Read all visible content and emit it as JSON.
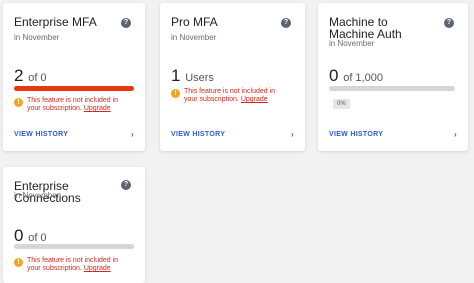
{
  "colors": {
    "accent_link": "#2a5bd7",
    "danger": "#d6261b",
    "warning_icon": "#f1a51d",
    "bar_fill_over": "#e8380d",
    "bar_track": "#d6d6d6"
  },
  "cards": [
    {
      "title": "Enterprise MFA",
      "period": "in November",
      "usage_value": "2",
      "usage_suffix": "of 0",
      "usage_fraction": 1.0,
      "warning_text": "This feature is not included in your subscription.",
      "warning_link": "Upgrade",
      "view_history": "VIEW HISTORY",
      "help_icon": "question-circle-icon",
      "warn_icon": "exclamation-circle-icon",
      "chevron_icon": "chevron-right-icon"
    },
    {
      "title": "Pro MFA",
      "period": "in November",
      "usage_value": "1",
      "usage_suffix": "Users",
      "warning_text": "This feature is not included in your subscription.",
      "warning_link": "Upgrade",
      "view_history": "VIEW HISTORY",
      "help_icon": "question-circle-icon",
      "warn_icon": "exclamation-circle-icon",
      "chevron_icon": "chevron-right-icon"
    },
    {
      "title": "Machine to Machine Auth",
      "period": "in November",
      "usage_value": "0",
      "usage_suffix": "of 1,000",
      "usage_fraction": 0.0,
      "percent_badge": "0%",
      "view_history": "VIEW HISTORY",
      "help_icon": "question-circle-icon",
      "chevron_icon": "chevron-right-icon"
    },
    {
      "title": "Enterprise Connections",
      "period": "in November",
      "usage_value": "0",
      "usage_suffix": "of 0",
      "usage_fraction": 0.0,
      "warning_text": "This feature is not included in your subscription.",
      "warning_link": "Upgrade",
      "help_icon": "question-circle-icon",
      "warn_icon": "exclamation-circle-icon"
    }
  ]
}
